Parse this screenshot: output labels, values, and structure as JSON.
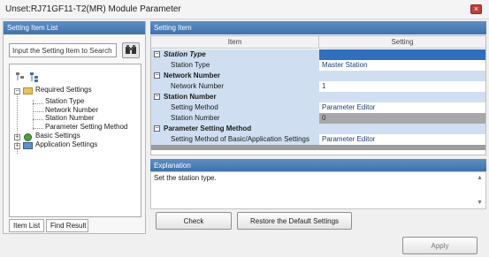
{
  "window": {
    "title": "Unset:RJ71GF11-T2(MR) Module Parameter",
    "close_glyph": "×"
  },
  "left_pane": {
    "header": "Setting Item List",
    "search_placeholder": "Input the Setting Item to Search",
    "tree": {
      "required": "Required Settings",
      "required_children": [
        "Station Type",
        "Network Number",
        "Station Number",
        "Parameter Setting Method"
      ],
      "basic": "Basic Settings",
      "application": "Application Settings"
    },
    "tabs": [
      "Item List",
      "Find Result"
    ]
  },
  "right_pane": {
    "header": "Setting Item",
    "columns": {
      "item": "Item",
      "setting": "Setting"
    },
    "rows": [
      {
        "kind": "category",
        "label": "Station Type",
        "italic": true
      },
      {
        "kind": "item",
        "label": "Station Type",
        "value": "Master Station"
      },
      {
        "kind": "category",
        "label": "Network Number"
      },
      {
        "kind": "item",
        "label": "Network Number",
        "value": "1"
      },
      {
        "kind": "category",
        "label": "Station Number"
      },
      {
        "kind": "item",
        "label": "Setting Method",
        "value": "Parameter Editor"
      },
      {
        "kind": "item",
        "label": "Station Number",
        "value": "0"
      },
      {
        "kind": "category",
        "label": "Parameter Setting Method"
      },
      {
        "kind": "item",
        "label": "Setting Method of Basic/Application Settings",
        "value": "Parameter Editor"
      }
    ]
  },
  "explanation": {
    "header": "Explanation",
    "text": "Set the station type."
  },
  "buttons": {
    "check": "Check",
    "restore": "Restore the Default Settings",
    "apply": "Apply"
  },
  "colors": {
    "header_blue": "#4a7fbb",
    "row_blue": "#cfdff1",
    "selection": "#2f6fc0",
    "disabled_gray": "#a8a8a8"
  }
}
